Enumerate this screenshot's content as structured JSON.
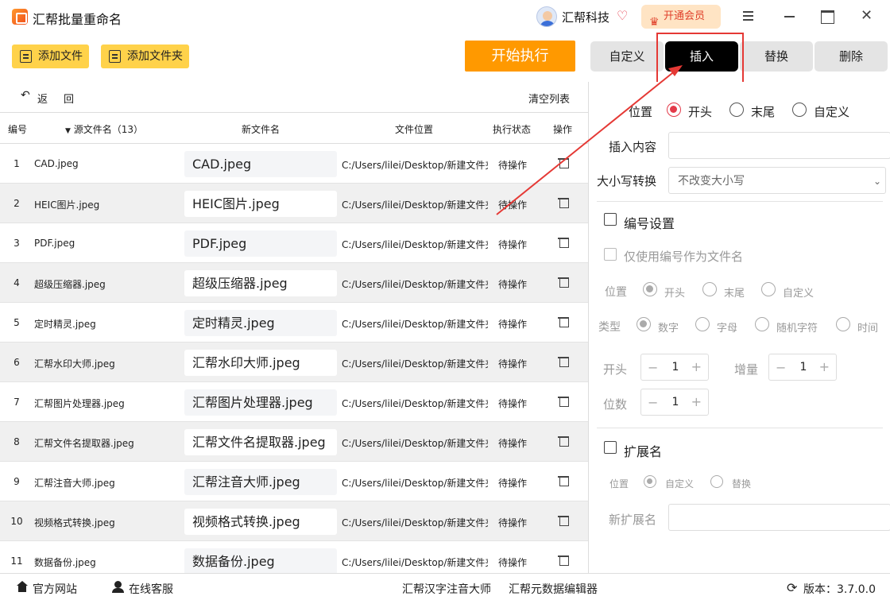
{
  "app": {
    "title": "汇帮批量重命名"
  },
  "account": {
    "company": "汇帮科技",
    "vip_label": "开通会员"
  },
  "toolbar": {
    "add_file": "添加文件",
    "add_folder": "添加文件夹",
    "start": "开始执行"
  },
  "tabs": [
    {
      "label": "自定义",
      "active": false
    },
    {
      "label": "插入",
      "active": true
    },
    {
      "label": "替换",
      "active": false
    },
    {
      "label": "删除",
      "active": false
    }
  ],
  "list": {
    "back": "返回",
    "clear": "清空列表",
    "headers": {
      "idx": "编号",
      "source": "源文件名（13）",
      "new_name": "新文件名",
      "path": "文件位置",
      "status": "执行状态",
      "action": "操作"
    },
    "rows": [
      {
        "idx": "1",
        "src": "CAD.jpeg",
        "new": "CAD.jpeg",
        "path": "C:/Users/lilei/Desktop/新建文件夹",
        "status": "待操作"
      },
      {
        "idx": "2",
        "src": "HEIC图片.jpeg",
        "new": "HEIC图片.jpeg",
        "path": "C:/Users/lilei/Desktop/新建文件夹",
        "status": "待操作"
      },
      {
        "idx": "3",
        "src": "PDF.jpeg",
        "new": "PDF.jpeg",
        "path": "C:/Users/lilei/Desktop/新建文件夹",
        "status": "待操作"
      },
      {
        "idx": "4",
        "src": "超级压缩器.jpeg",
        "new": "超级压缩器.jpeg",
        "path": "C:/Users/lilei/Desktop/新建文件夹",
        "status": "待操作"
      },
      {
        "idx": "5",
        "src": "定时精灵.jpeg",
        "new": "定时精灵.jpeg",
        "path": "C:/Users/lilei/Desktop/新建文件夹",
        "status": "待操作"
      },
      {
        "idx": "6",
        "src": "汇帮水印大师.jpeg",
        "new": "汇帮水印大师.jpeg",
        "path": "C:/Users/lilei/Desktop/新建文件夹",
        "status": "待操作"
      },
      {
        "idx": "7",
        "src": "汇帮图片处理器.jpeg",
        "new": "汇帮图片处理器.jpeg",
        "path": "C:/Users/lilei/Desktop/新建文件夹",
        "status": "待操作"
      },
      {
        "idx": "8",
        "src": "汇帮文件名提取器.jpeg",
        "new": "汇帮文件名提取器.jpeg",
        "path": "C:/Users/lilei/Desktop/新建文件夹",
        "status": "待操作"
      },
      {
        "idx": "9",
        "src": "汇帮注音大师.jpeg",
        "new": "汇帮注音大师.jpeg",
        "path": "C:/Users/lilei/Desktop/新建文件夹",
        "status": "待操作"
      },
      {
        "idx": "10",
        "src": "视频格式转换.jpeg",
        "new": "视频格式转换.jpeg",
        "path": "C:/Users/lilei/Desktop/新建文件夹",
        "status": "待操作"
      },
      {
        "idx": "11",
        "src": "数据备份.jpeg",
        "new": "数据备份.jpeg",
        "path": "C:/Users/lilei/Desktop/新建文件夹",
        "status": "待操作"
      }
    ]
  },
  "panel": {
    "position_label": "位置",
    "position_options": [
      "开头",
      "末尾",
      "自定义"
    ],
    "position_selected": "开头",
    "insert_label": "插入内容",
    "insert_value": "",
    "case_label": "大小写转换",
    "case_value": "不改变大小写",
    "numbering": {
      "title": "编号设置",
      "only_number": "仅使用编号作为文件名",
      "position_label": "位置",
      "position_options": [
        "开头",
        "末尾",
        "自定义"
      ],
      "type_label": "类型",
      "type_options": [
        "数字",
        "字母",
        "随机字符",
        "时间"
      ],
      "start_label": "开头",
      "start_value": "1",
      "step_label": "增量",
      "step_value": "1",
      "digits_label": "位数",
      "digits_value": "1"
    },
    "extension": {
      "title": "扩展名",
      "position_label": "位置",
      "options": [
        "自定义",
        "替换"
      ],
      "new_ext_label": "新扩展名",
      "new_ext_value": ""
    }
  },
  "statusbar": {
    "website": "官方网站",
    "service": "在线客服",
    "link1": "汇帮汉字注音大师",
    "link2": "汇帮元数据编辑器",
    "version": "版本：3.7.0.0"
  }
}
